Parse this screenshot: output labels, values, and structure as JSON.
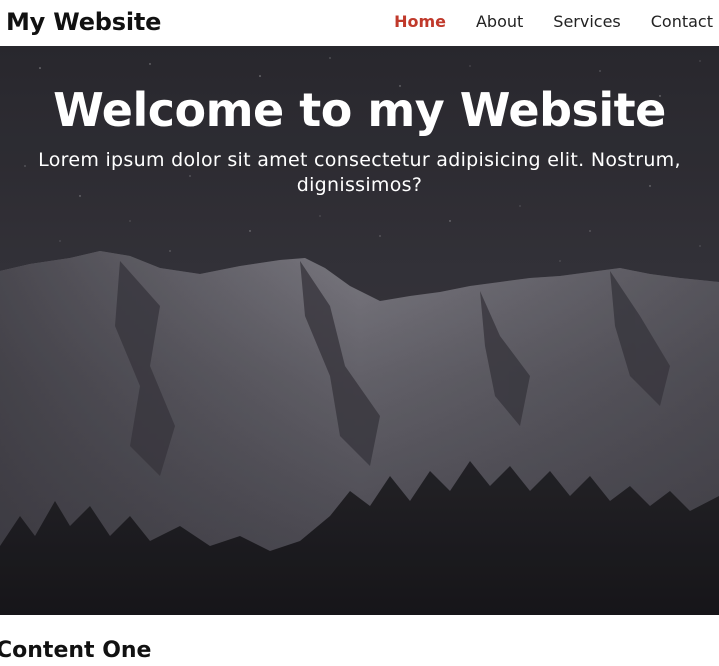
{
  "header": {
    "brand": "My Website",
    "nav": [
      {
        "label": "Home",
        "active": true
      },
      {
        "label": "About",
        "active": false
      },
      {
        "label": "Services",
        "active": false
      },
      {
        "label": "Contact",
        "active": false
      }
    ],
    "active_color": "#c0392b"
  },
  "hero": {
    "title": "Welcome to my Website",
    "text": "Lorem ipsum dolor sit amet consectetur adipisicing elit. Nostrum, dignissimos?"
  },
  "content": {
    "section_title": "Content One"
  }
}
